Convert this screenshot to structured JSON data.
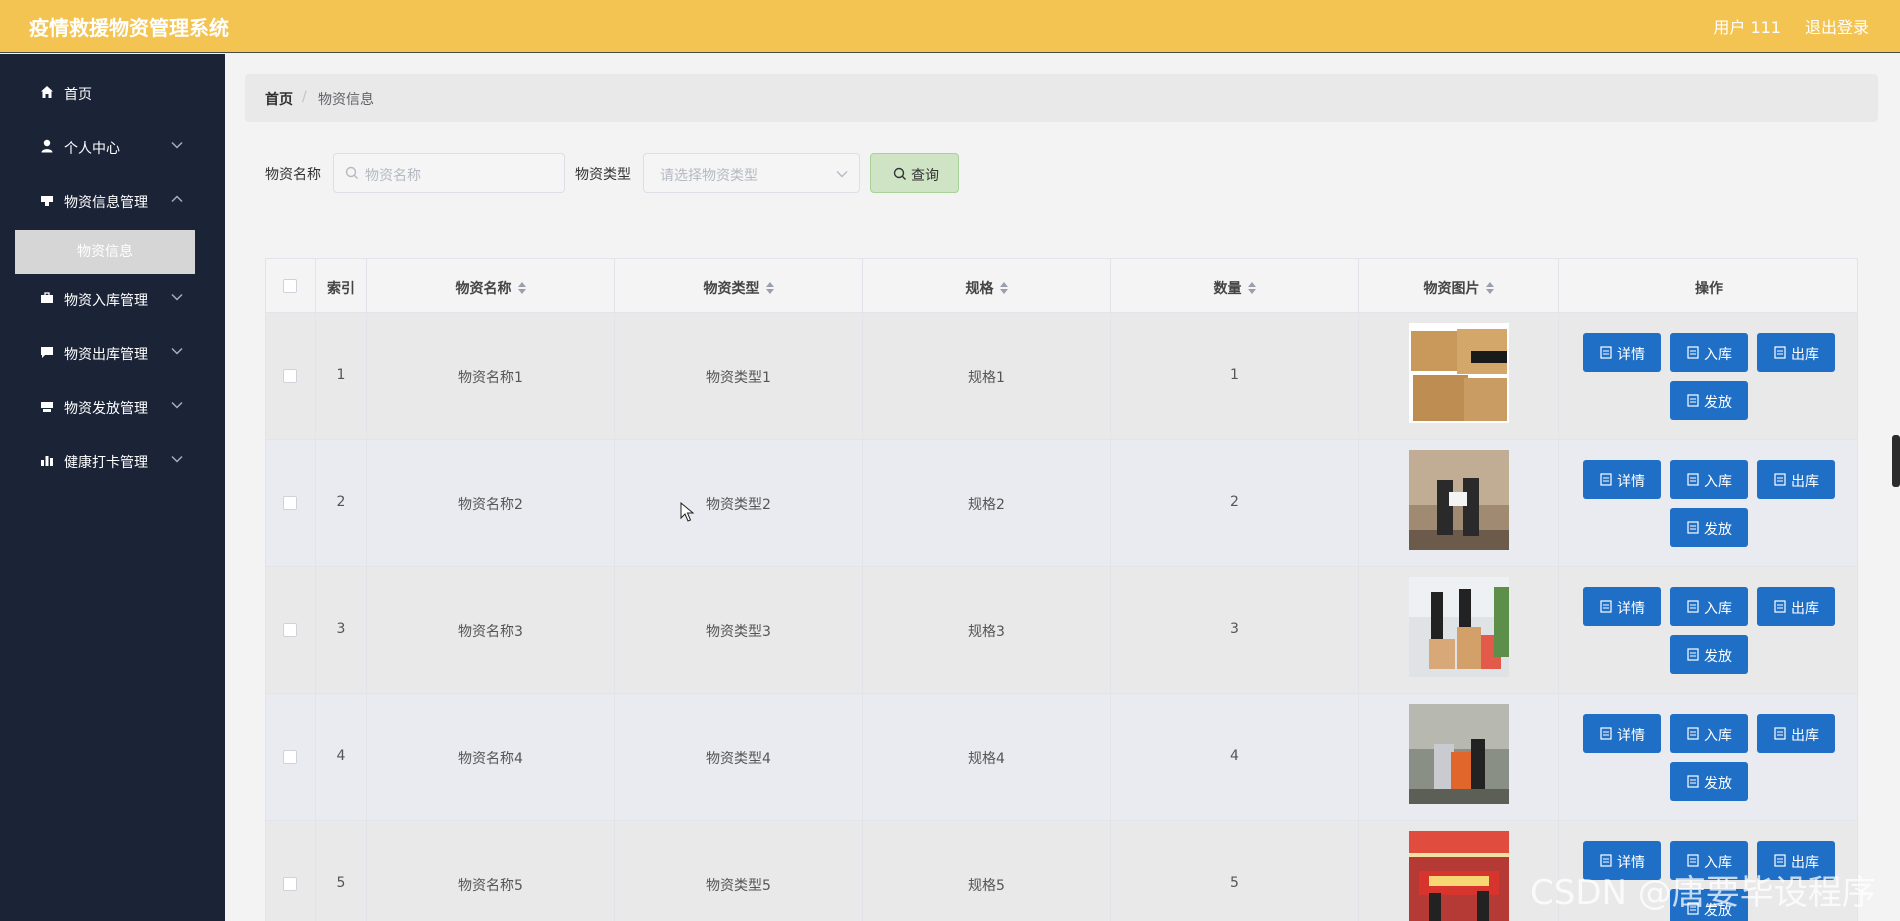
{
  "header": {
    "title": "疫情救援物资管理系统",
    "user": "用户 111",
    "logout": "退出登录"
  },
  "sidebar": {
    "items": [
      {
        "label": "首页",
        "icon": "home-icon"
      },
      {
        "label": "个人中心",
        "icon": "user-icon"
      },
      {
        "label": "物资信息管理",
        "icon": "box-icon"
      },
      {
        "label": "物资入库管理",
        "icon": "briefcase-icon"
      },
      {
        "label": "物资出库管理",
        "icon": "message-icon"
      },
      {
        "label": "物资发放管理",
        "icon": "box-icon"
      },
      {
        "label": "健康打卡管理",
        "icon": "bar-chart-icon"
      }
    ],
    "active_sub": "物资信息"
  },
  "breadcrumb": {
    "home": "首页",
    "separator": "/",
    "current": "物资信息"
  },
  "search": {
    "name_label": "物资名称",
    "name_placeholder": "物资名称",
    "type_label": "物资类型",
    "type_placeholder": "请选择物资类型",
    "query_button": "查询"
  },
  "table": {
    "headers": {
      "index": "索引",
      "name": "物资名称",
      "type": "物资类型",
      "spec": "规格",
      "qty": "数量",
      "image": "物资图片",
      "ops": "操作"
    },
    "rows": [
      {
        "index": "1",
        "name": "物资名称1",
        "type": "物资类型1",
        "spec": "规格1",
        "qty": "1"
      },
      {
        "index": "2",
        "name": "物资名称2",
        "type": "物资类型2",
        "spec": "规格2",
        "qty": "2"
      },
      {
        "index": "3",
        "name": "物资名称3",
        "type": "物资类型3",
        "spec": "规格3",
        "qty": "3"
      },
      {
        "index": "4",
        "name": "物资名称4",
        "type": "物资类型4",
        "spec": "规格4",
        "qty": "4"
      },
      {
        "index": "5",
        "name": "物资名称5",
        "type": "物资类型5",
        "spec": "规格5",
        "qty": "5"
      }
    ],
    "actions": {
      "detail": "详情",
      "stock_in": "入库",
      "stock_out": "出库",
      "distribute": "发放"
    }
  },
  "watermark": "CSDN @唐要毕设程序",
  "colors": {
    "header": "#f3c452",
    "sidebar": "#1b2337",
    "action_button": "#1f6fc6",
    "query_button": "#cfe4c5"
  }
}
